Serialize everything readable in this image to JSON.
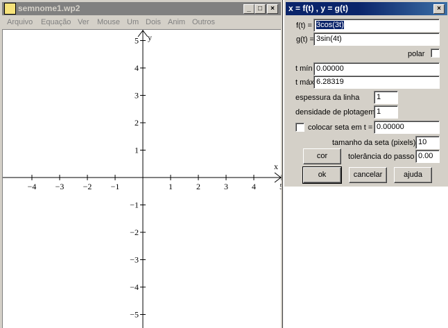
{
  "main_window": {
    "title": "semnome1.wp2",
    "caption_buttons": {
      "minimize": "_",
      "maximize": "□",
      "close": "×"
    },
    "menu": [
      "Arquivo",
      "Equação",
      "Ver",
      "Mouse",
      "Um",
      "Dois",
      "Anim",
      "Outros"
    ]
  },
  "plot": {
    "x_label": "x",
    "y_label": "y",
    "x_ticks": [
      "−4",
      "−3",
      "−2",
      "−1",
      "1",
      "2",
      "3",
      "4",
      "5"
    ],
    "y_ticks": [
      "5",
      "4",
      "3",
      "2",
      "1",
      "−1",
      "−2",
      "−3",
      "−4",
      "−5"
    ]
  },
  "dialog": {
    "title": "x = f(t) , y = g(t)",
    "close_glyph": "×",
    "f_label": "f(t) =",
    "f_value": "3cos(3t)",
    "g_label": "g(t) =",
    "g_value": "3sin(4t)",
    "polar_label": "polar",
    "polar_checked": false,
    "tmin_label": "t mín",
    "tmin_value": "0.00000",
    "tmax_label": "t máx",
    "tmax_value": "6.28319",
    "line_width_label": "espessura da linha",
    "line_width_value": "1",
    "density_label": "densidade de plotagem",
    "density_value": "1",
    "arrow_label": "colocar seta em t =",
    "arrow_checked": false,
    "arrow_value": "0.00000",
    "arrow_size_label": "tamanho da seta (pixels)",
    "arrow_size_value": "10",
    "color_button": "cor",
    "step_tolerance_label": "tolerância do passo",
    "step_tolerance_value": "0.00",
    "ok_button": "ok",
    "cancel_button": "cancelar",
    "help_button": "ajuda"
  }
}
